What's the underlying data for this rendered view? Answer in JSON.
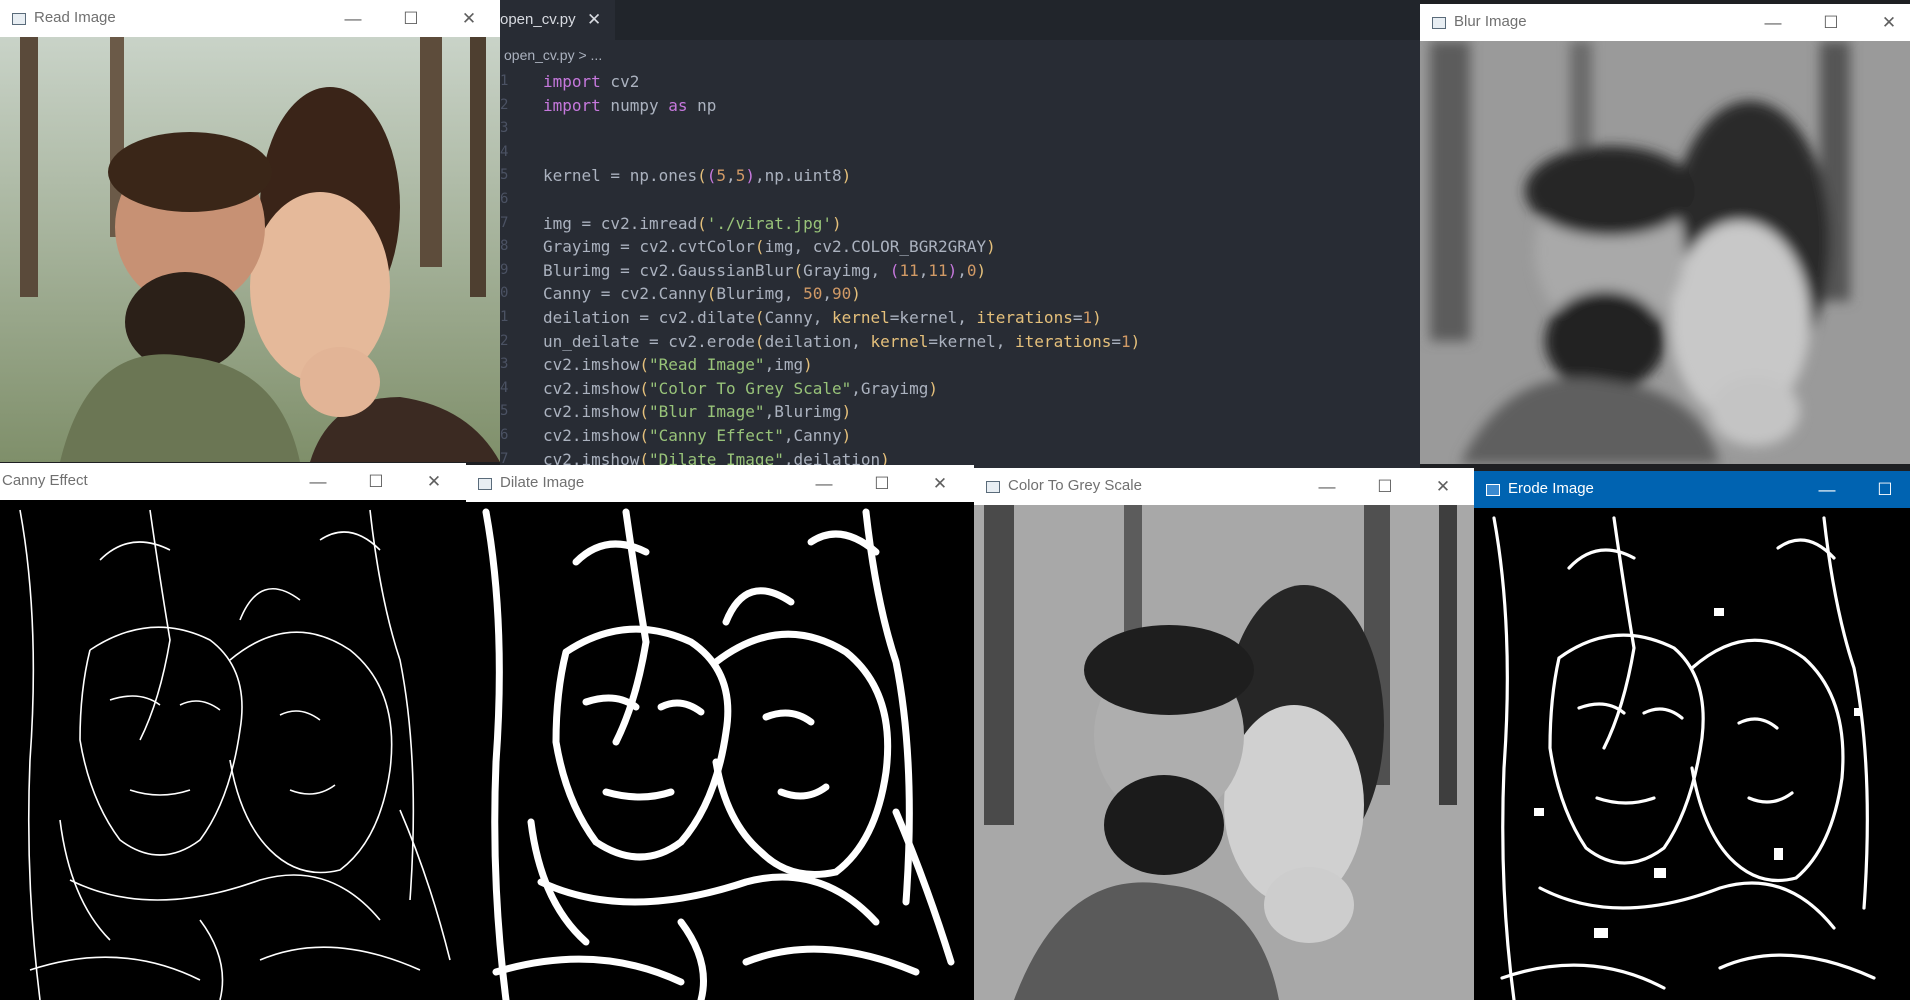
{
  "editor": {
    "tab_label": "open_cv.py",
    "tab_close": "✕",
    "breadcrumb_file": "open_cv.py",
    "breadcrumb_rest": " > ...",
    "line_numbers": [
      "1",
      "2",
      "3",
      "4",
      "5",
      "6",
      "7",
      "8",
      "9",
      "0",
      "1",
      "2",
      "3",
      "4",
      "5",
      "6",
      "7"
    ]
  },
  "windows": {
    "read": {
      "title": "Read Image"
    },
    "blur": {
      "title": "Blur Image"
    },
    "canny": {
      "title": "Canny Effect"
    },
    "dilate": {
      "title": "Dilate Image"
    },
    "grey": {
      "title": "Color To Grey Scale"
    },
    "erode": {
      "title": "Erode Image"
    }
  },
  "controls": {
    "minimize": "—",
    "maximize": "☐",
    "close": "✕"
  },
  "colors": {
    "editor_bg": "#282c34",
    "active_title": "#0063b1",
    "keyword": "#c678dd",
    "string": "#98c379",
    "number": "#d19a66"
  }
}
